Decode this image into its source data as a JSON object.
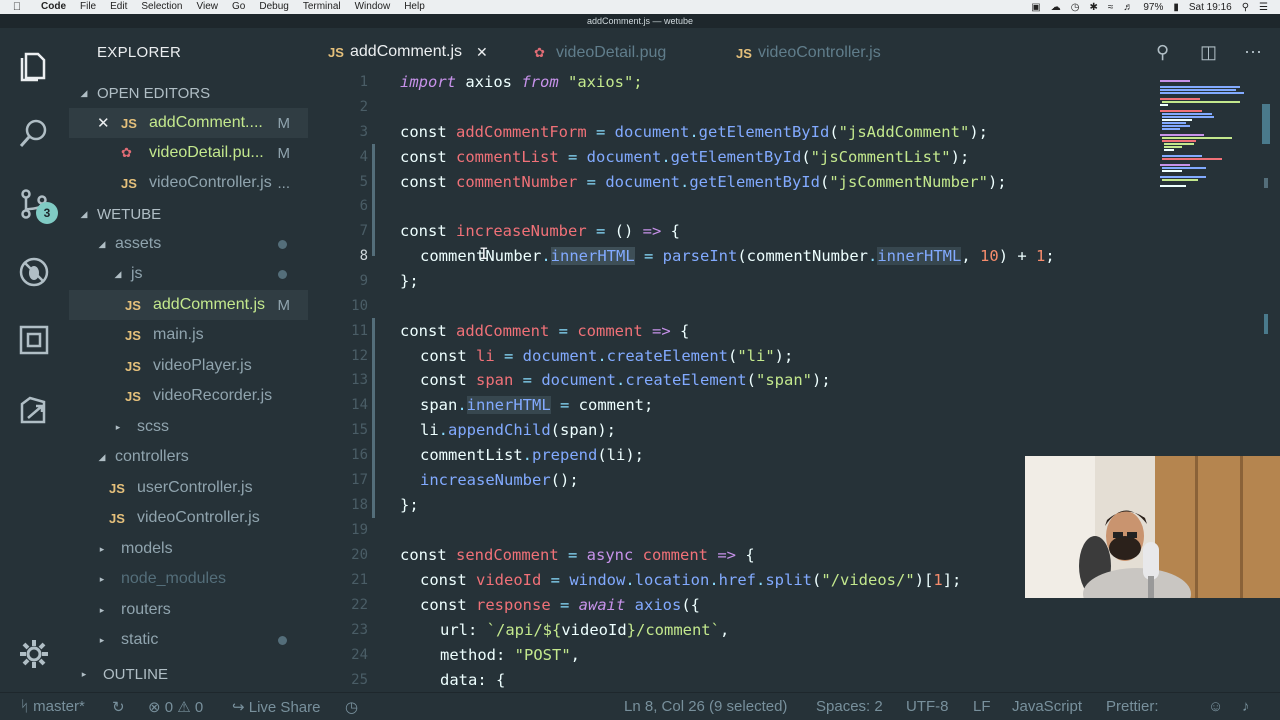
{
  "menubar": {
    "app": "Code",
    "items": [
      "File",
      "Edit",
      "Selection",
      "View",
      "Go",
      "Debug",
      "Terminal",
      "Window",
      "Help"
    ],
    "battery": "97%",
    "clock": "Sat 19:16"
  },
  "window_title": "addComment.js — wetube",
  "sidebar": {
    "header": "EXPLORER",
    "open_editors_label": "OPEN EDITORS",
    "open_editors": [
      {
        "name": "addComment....",
        "status": "M",
        "icon": "js"
      },
      {
        "name": "videoDetail.pu...",
        "status": "M",
        "icon": "pug"
      },
      {
        "name": "videoController.js",
        "status": "...",
        "icon": "js"
      }
    ],
    "project_label": "WETUBE",
    "tree": {
      "assets": "assets",
      "js": "js",
      "addComment": "addComment.js",
      "addComment_status": "M",
      "main": "main.js",
      "videoPlayer": "videoPlayer.js",
      "videoRecorder": "videoRecorder.js",
      "scss": "scss",
      "controllers": "controllers",
      "userController": "userController.js",
      "videoController": "videoController.js",
      "models": "models",
      "node_modules": "node_modules",
      "routers": "routers",
      "static": "static"
    },
    "outline_label": "OUTLINE",
    "scm_badge": "3"
  },
  "tabs": [
    {
      "label": "addComment.js",
      "icon": "js"
    },
    {
      "label": "videoDetail.pug",
      "icon": "pug"
    },
    {
      "label": "videoController.js",
      "icon": "js"
    }
  ],
  "line_numbers": [
    "1",
    "2",
    "3",
    "4",
    "5",
    "6",
    "7",
    "8",
    "9",
    "10",
    "11",
    "12",
    "13",
    "14",
    "15",
    "16",
    "17",
    "18",
    "19",
    "20",
    "21",
    "22",
    "23",
    "24",
    "25"
  ],
  "code_tokens": {
    "l1": [
      "import",
      " axios ",
      "from",
      " \"axios\";"
    ],
    "l3": [
      "const ",
      "addCommentForm",
      " = ",
      "document",
      ".",
      "getElementById",
      "(",
      "\"jsAddComment\"",
      ");"
    ],
    "l4": [
      "const ",
      "commentList",
      " = ",
      "document",
      ".",
      "getElementById",
      "(",
      "\"jsCommentList\"",
      ");"
    ],
    "l5": [
      "const ",
      "commentNumber",
      " = ",
      "document",
      ".",
      "getElementById",
      "(",
      "\"jsCommentNumber\"",
      ");"
    ],
    "l7": [
      "const ",
      "increaseNumber",
      " = ",
      "()",
      " => ",
      "{"
    ],
    "l8": [
      "commentNumber",
      ".",
      "innerHTML",
      " = ",
      "parseInt",
      "(",
      "commentNumber",
      ".",
      "innerHTML",
      ", ",
      "10",
      ") + ",
      "1",
      ";"
    ],
    "l9": [
      "};"
    ],
    "l11": [
      "const ",
      "addComment",
      " = ",
      "comment",
      " => ",
      "{"
    ],
    "l12": [
      "const ",
      "li",
      " = ",
      "document",
      ".",
      "createElement",
      "(",
      "\"li\"",
      ");"
    ],
    "l13": [
      "const ",
      "span",
      " = ",
      "document",
      ".",
      "createElement",
      "(",
      "\"span\"",
      ");"
    ],
    "l14": [
      "span",
      ".",
      "innerHTML",
      " = ",
      "comment",
      ";"
    ],
    "l15": [
      "li",
      ".",
      "appendChild",
      "(span);"
    ],
    "l16": [
      "commentList",
      ".",
      "prepend",
      "(li);"
    ],
    "l17": [
      "increaseNumber",
      "();"
    ],
    "l18": [
      "};"
    ],
    "l20": [
      "const ",
      "sendComment",
      " = ",
      "async ",
      "comment",
      " => ",
      "{"
    ],
    "l21": [
      "const ",
      "videoId",
      " = ",
      "window",
      ".",
      "location",
      ".",
      "href",
      ".",
      "split",
      "(",
      "\"/videos/\"",
      ")[",
      "1",
      "];"
    ],
    "l22": [
      "const ",
      "response",
      " = ",
      "await ",
      "axios",
      "({"
    ],
    "l23": [
      "url: ",
      "`/api/${",
      "videoId",
      "}/comment`",
      ","
    ],
    "l24": [
      "method: ",
      "\"POST\"",
      ","
    ],
    "l25": [
      "data: ",
      "{"
    ]
  },
  "status": {
    "branch": "master*",
    "errors": "0",
    "warnings": "0",
    "live_share": "Live Share",
    "position": "Ln 8, Col 26 (9 selected)",
    "spaces": "Spaces: 2",
    "encoding": "UTF-8",
    "eol": "LF",
    "language": "JavaScript",
    "formatter": "Prettier:"
  },
  "colors": {
    "accent": "#80cbc4",
    "background": "#263238",
    "keyword": "#c792ea",
    "variable": "#f07178",
    "function": "#82aaff",
    "string": "#c3e88d",
    "number": "#f78c6c"
  }
}
